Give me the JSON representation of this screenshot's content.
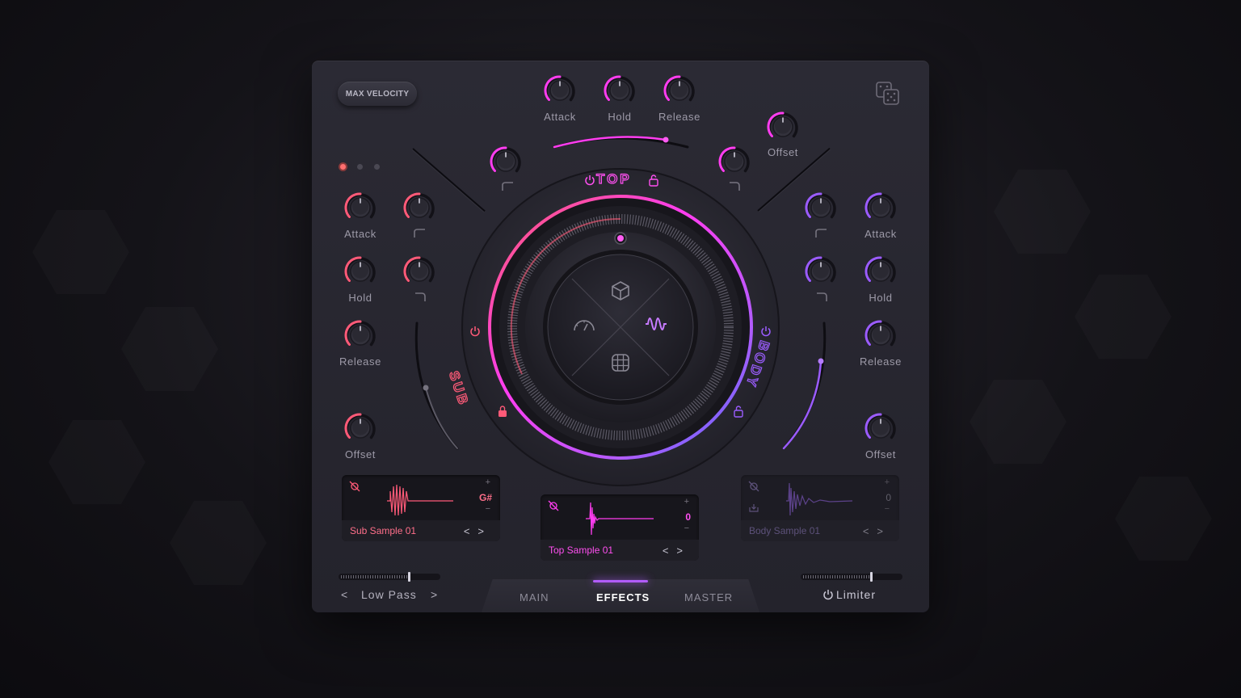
{
  "header": {
    "max_velocity_label": "MAX VELOCITY"
  },
  "accents": {
    "sub": "#ff5a78",
    "top": "#ff3df0",
    "body": "#9b5cff"
  },
  "top_envelope": {
    "attack": "Attack",
    "hold": "Hold",
    "release": "Release"
  },
  "offset_top_right": "Offset",
  "left_section": {
    "attack": "Attack",
    "hold": "Hold",
    "release": "Release",
    "offset": "Offset"
  },
  "right_section": {
    "attack": "Attack",
    "hold": "Hold",
    "release": "Release",
    "offset": "Offset"
  },
  "wheel": {
    "top_label": "TOP",
    "sub_label": "SUB",
    "body_label": "BODY"
  },
  "samples": {
    "sub": {
      "name": "Sub Sample 01",
      "note": "G#",
      "plus": "+",
      "minus": "−",
      "prev": "<",
      "next": ">"
    },
    "top": {
      "name": "Top Sample 01",
      "value": "0",
      "plus": "+",
      "minus": "−",
      "prev": "<",
      "next": ">"
    },
    "body": {
      "name": "Body Sample 01",
      "value": "0",
      "plus": "+",
      "minus": "−",
      "prev": "<",
      "next": ">"
    }
  },
  "filter": {
    "prev": "<",
    "label": "Low Pass",
    "next": ">"
  },
  "tabs": [
    "MAIN",
    "EFFECTS",
    "MASTER"
  ],
  "limiter": {
    "label": "Limiter"
  },
  "icons": [
    "dice-icon",
    "power-icon",
    "lock-icon",
    "cube-icon",
    "gauge-icon",
    "waveform-icon",
    "grid-icon",
    "mute-icon"
  ]
}
